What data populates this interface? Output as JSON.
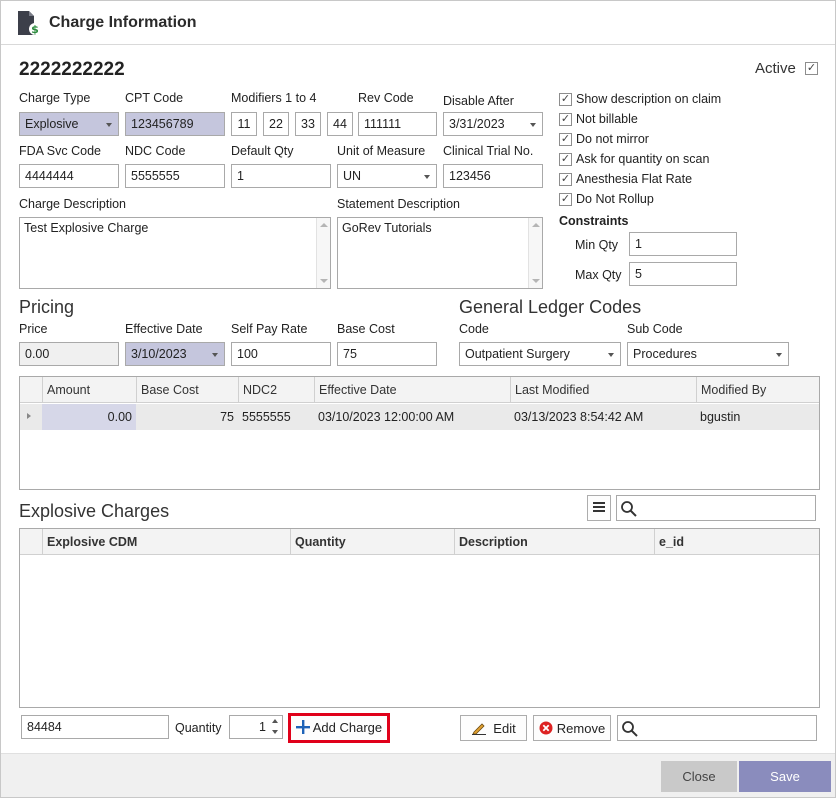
{
  "window": {
    "title": "Charge Information"
  },
  "record": {
    "id": "2222222222",
    "active_label": "Active",
    "active_checked": "✓"
  },
  "labels": {
    "charge_type": "Charge Type",
    "cpt_code": "CPT Code",
    "modifiers": "Modifiers 1 to 4",
    "rev_code": "Rev Code",
    "disable_after": "Disable After",
    "fda_svc_code": "FDA Svc Code",
    "ndc_code": "NDC Code",
    "default_qty": "Default Qty",
    "unit_of_measure": "Unit of Measure",
    "clinical_trial_no": "Clinical Trial No.",
    "charge_description": "Charge Description",
    "statement_description": "Statement Description"
  },
  "fields": {
    "charge_type": "Explosive",
    "cpt_code": "123456789",
    "modifiers": [
      "11",
      "22",
      "33",
      "44"
    ],
    "rev_code": "111111",
    "disable_after": "3/31/2023",
    "fda_svc_code": "4444444",
    "ndc_code": "5555555",
    "default_qty": "1",
    "unit_of_measure": "UN",
    "clinical_trial_no": "123456",
    "charge_description": "Test Explosive Charge",
    "statement_description": "GoRev Tutorials"
  },
  "options": {
    "show_description": {
      "label": "Show description on claim",
      "mark": "✓"
    },
    "not_billable": {
      "label": "Not billable",
      "mark": "✓"
    },
    "do_not_mirror": {
      "label": "Do not mirror",
      "mark": "✓"
    },
    "ask_quantity": {
      "label": "Ask for quantity on scan",
      "mark": "✓"
    },
    "anesthesia_flat": {
      "label": "Anesthesia Flat Rate",
      "mark": "✓"
    },
    "do_not_rollup": {
      "label": "Do Not Rollup",
      "mark": "✓"
    }
  },
  "constraints": {
    "title": "Constraints",
    "min_label": "Min Qty",
    "min_value": "1",
    "max_label": "Max Qty",
    "max_value": "5"
  },
  "pricing": {
    "title": "Pricing",
    "price_label": "Price",
    "price": "0.00",
    "effective_label": "Effective Date",
    "effective_date": "3/10/2023",
    "self_pay_label": "Self Pay Rate",
    "self_pay": "100",
    "base_cost_label": "Base Cost",
    "base_cost": "75"
  },
  "gl": {
    "title": "General Ledger Codes",
    "code_label": "Code",
    "code": "Outpatient Surgery",
    "sub_label": "Sub Code",
    "sub_code": "Procedures"
  },
  "price_grid": {
    "columns": [
      "Amount",
      "Base Cost",
      "NDC2",
      "Effective Date",
      "Last Modified",
      "Modified By"
    ],
    "row": [
      "0.00",
      "75",
      "5555555",
      "03/10/2023 12:00:00 AM",
      "03/13/2023 8:54:42 AM",
      "bgustin"
    ]
  },
  "explosive": {
    "title": "Explosive Charges",
    "columns": [
      "Explosive CDM",
      "Quantity",
      "Description",
      "e_id"
    ],
    "cdm_value": "84484",
    "quantity_label": "Quantity",
    "quantity_value": "1",
    "add_label": "Add Charge",
    "edit_label": "Edit",
    "remove_label": "Remove"
  },
  "footer": {
    "close": "Close",
    "save": "Save"
  },
  "colors": {
    "accent": "#8a8cbd",
    "highlight": "#e0001a",
    "lavender": "#c5c6dd"
  }
}
